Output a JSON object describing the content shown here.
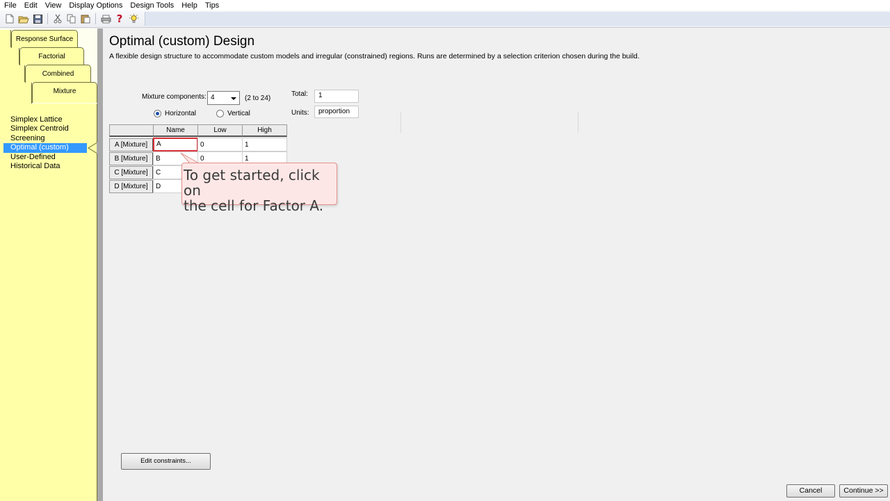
{
  "menu": [
    "File",
    "Edit",
    "View",
    "Display Options",
    "Design Tools",
    "Help",
    "Tips"
  ],
  "toolbar": {
    "icons": [
      "new-file-icon",
      "open-folder-icon",
      "save-icon",
      "cut-icon",
      "copy-icon",
      "paste-icon",
      "print-icon",
      "help-question-icon",
      "lightbulb-icon"
    ],
    "help_glyph": "?"
  },
  "design_tabs": [
    "Response Surface",
    "Factorial",
    "Combined",
    "Mixture"
  ],
  "design_list": {
    "items": [
      "Simplex Lattice",
      "Simplex Centroid",
      "Screening",
      "Optimal (custom)",
      "User-Defined",
      "Historical Data"
    ],
    "selected": "Optimal (custom)"
  },
  "page": {
    "title": "Optimal (custom) Design",
    "description": "A flexible design structure to accommodate custom models and irregular (constrained) regions.  Runs are determined by a selection criterion chosen during the build."
  },
  "components": {
    "label": "Mixture components:",
    "value": "4",
    "range_hint": "(2 to 24)"
  },
  "orientation": {
    "horizontal": "Horizontal",
    "vertical": "Vertical",
    "selected": "Horizontal"
  },
  "total": {
    "label": "Total:",
    "value": "1"
  },
  "units": {
    "label": "Units:",
    "value": "proportion"
  },
  "factor_table": {
    "columns": [
      "Name",
      "Low",
      "High"
    ],
    "rows": [
      {
        "header": "A [Mixture]",
        "name": "A",
        "low": "0",
        "high": "1"
      },
      {
        "header": "B [Mixture]",
        "name": "B",
        "low": "0",
        "high": "1"
      },
      {
        "header": "C [Mixture]",
        "name": "C",
        "low": "",
        "high": ""
      },
      {
        "header": "D [Mixture]",
        "name": "D",
        "low": "",
        "high": ""
      }
    ]
  },
  "callout": {
    "text": "To get started, click on\nthe cell for Factor A."
  },
  "buttons": {
    "edit_constraints": "Edit constraints...",
    "cancel": "Cancel",
    "continue": "Continue >>"
  },
  "colors": {
    "panel_yellow": "#ffffa8",
    "selection_blue": "#3399ff",
    "callout_bg": "#fde7e6",
    "active_cell_border": "#d8333a"
  }
}
